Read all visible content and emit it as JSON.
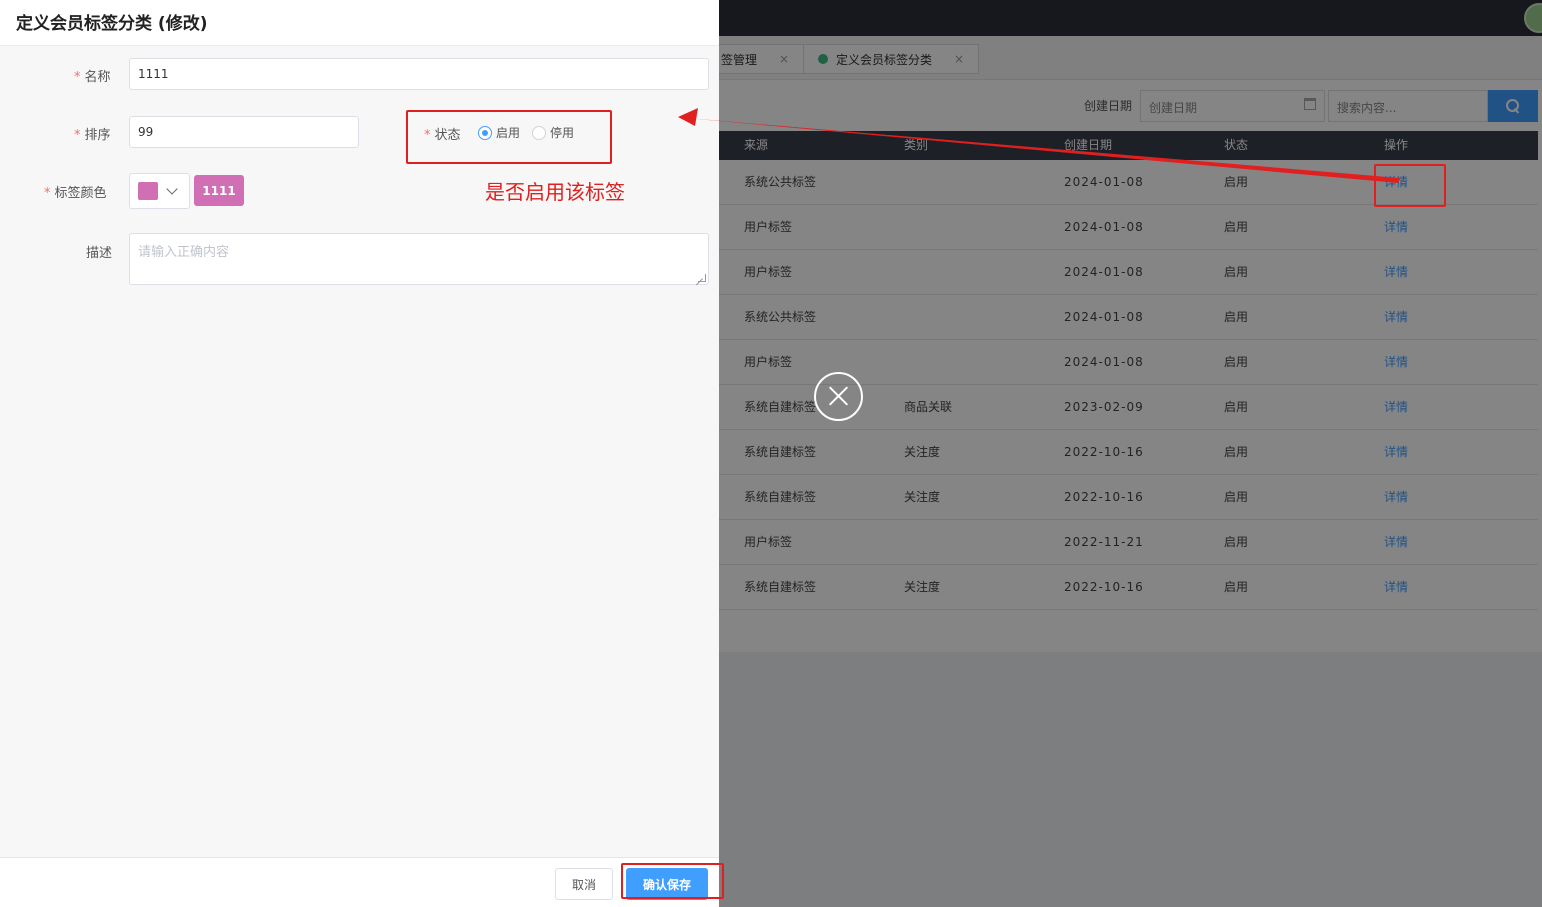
{
  "background": {
    "tabs": [
      {
        "label": "签管理",
        "close": "×"
      },
      {
        "label": "定义会员标签分类",
        "close": "×"
      }
    ],
    "filter": {
      "date_label": "创建日期",
      "date_placeholder": "创建日期",
      "search_placeholder": "搜索内容..."
    },
    "table": {
      "headers": {
        "source": "来源",
        "category": "类别",
        "date": "创建日期",
        "status": "状态",
        "op": "操作"
      },
      "rows": [
        {
          "source": "系统公共标签",
          "category": "",
          "date": "2024-01-08",
          "status": "启用",
          "op": "详情"
        },
        {
          "source": "用户标签",
          "category": "",
          "date": "2024-01-08",
          "status": "启用",
          "op": "详情"
        },
        {
          "source": "用户标签",
          "category": "",
          "date": "2024-01-08",
          "status": "启用",
          "op": "详情"
        },
        {
          "source": "系统公共标签",
          "category": "",
          "date": "2024-01-08",
          "status": "启用",
          "op": "详情"
        },
        {
          "source": "用户标签",
          "category": "",
          "date": "2024-01-08",
          "status": "启用",
          "op": "详情"
        },
        {
          "source": "系统自建标签",
          "category": "商品关联",
          "date": "2023-02-09",
          "status": "启用",
          "op": "详情"
        },
        {
          "source": "系统自建标签",
          "category": "关注度",
          "date": "2022-10-16",
          "status": "启用",
          "op": "详情"
        },
        {
          "source": "系统自建标签",
          "category": "关注度",
          "date": "2022-10-16",
          "status": "启用",
          "op": "详情"
        },
        {
          "source": "用户标签",
          "category": "",
          "date": "2022-11-21",
          "status": "启用",
          "op": "详情"
        },
        {
          "source": "系统自建标签",
          "category": "关注度",
          "date": "2022-10-16",
          "status": "启用",
          "op": "详情"
        }
      ]
    }
  },
  "drawer": {
    "title": "定义会员标签分类 (修改)",
    "required_mark": "*",
    "fields": {
      "name": {
        "label": "名称",
        "value": "1111"
      },
      "sort": {
        "label": "排序",
        "value": "99"
      },
      "status": {
        "label": "状态",
        "options": [
          "启用",
          "停用"
        ],
        "selected": "启用"
      },
      "color": {
        "label": "标签颜色",
        "color": "#d16fb5",
        "tag_text": "1111"
      },
      "description": {
        "label": "描述",
        "placeholder": "请输入正确内容"
      }
    },
    "footer": {
      "cancel": "取消",
      "save": "确认保存"
    }
  },
  "annotation": {
    "text": "是否启用该标签",
    "color": "#e02020"
  },
  "colors": {
    "primary": "#409eff",
    "header_dark": "#3a3f4b",
    "topbar": "#2b2f3a"
  },
  "icons": [
    "close-circle-icon",
    "calendar-icon",
    "search-icon",
    "chevron-down-icon",
    "tab-status-dot-icon"
  ]
}
